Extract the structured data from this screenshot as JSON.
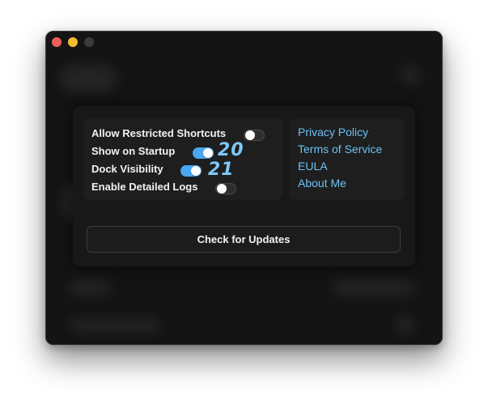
{
  "window": {
    "controls": [
      "close",
      "minimize",
      "zoom"
    ],
    "colors": {
      "close": "#ee5f57",
      "minimize": "#f4bd2e",
      "zoom": "#3b3b3b"
    }
  },
  "settings": [
    {
      "label": "Allow Restricted Shortcuts",
      "enabled": false,
      "annotation": ""
    },
    {
      "label": "Show on Startup",
      "enabled": true,
      "annotation": "20"
    },
    {
      "label": "Dock Visibility",
      "enabled": true,
      "annotation": "21"
    },
    {
      "label": "Enable Detailed Logs",
      "enabled": false,
      "annotation": ""
    }
  ],
  "links": [
    "Privacy Policy",
    "Terms of Service",
    "EULA",
    "About Me"
  ],
  "update_button_label": "Check for Updates",
  "colors": {
    "accent": "#4aa8f0",
    "link": "#6cc0f4",
    "annotation": "#7ec8f6"
  }
}
